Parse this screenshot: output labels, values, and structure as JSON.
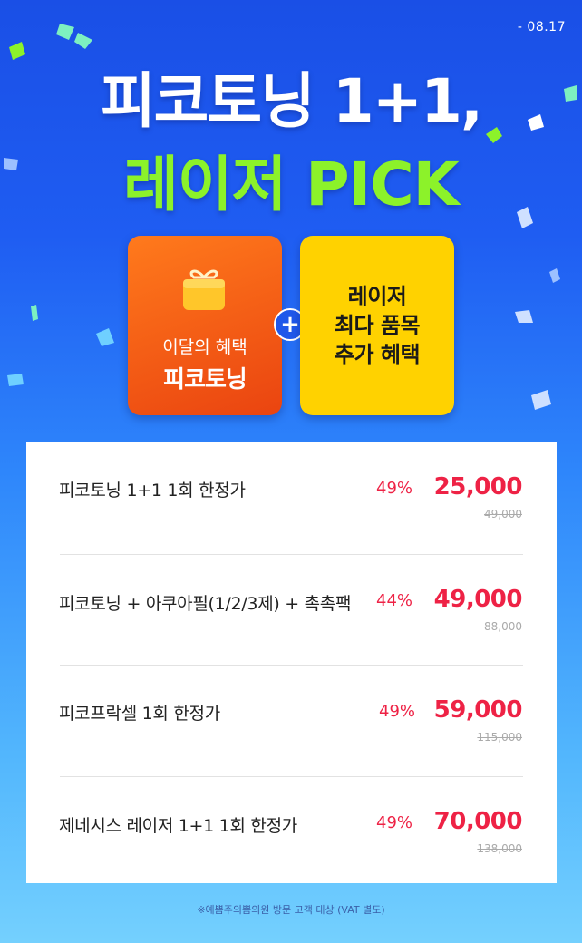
{
  "date_label": "- 08.17",
  "headline": {
    "line1": "피코토닝 1+1,",
    "line2": "레이저 PICK"
  },
  "cards": {
    "left": {
      "subtitle": "이달의 혜택",
      "title": "피코토닝"
    },
    "plus_symbol": "+",
    "right": {
      "line1": "레이저",
      "line2": "최다 품목",
      "line3": "추가 혜택"
    }
  },
  "price_list": [
    {
      "name": "피코토닝 1+1 1회 한정가",
      "discount": "49%",
      "price": "25,000",
      "original": "49,000"
    },
    {
      "name": "피코토닝 + 아쿠아필(1/2/3제) + 촉촉팩",
      "discount": "44%",
      "price": "49,000",
      "original": "88,000"
    },
    {
      "name": "피코프락셀 1회 한정가",
      "discount": "49%",
      "price": "59,000",
      "original": "115,000"
    },
    {
      "name": "제네시스 레이저 1+1 1회 한정가",
      "discount": "49%",
      "price": "70,000",
      "original": "138,000"
    }
  ],
  "footnote": "※예쁨주의쁨의원 방문 고객 대상 (VAT 별도)",
  "colors": {
    "accent_red": "#ee2245",
    "lime": "#8cf22a",
    "orange": "#ea4410",
    "yellow": "#ffd200",
    "blue": "#1a4fe6"
  }
}
